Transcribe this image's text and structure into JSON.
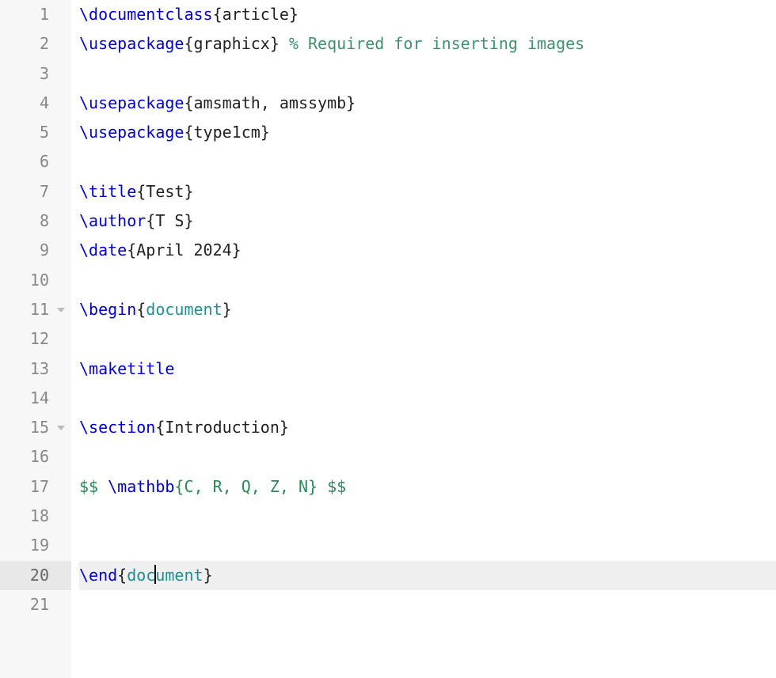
{
  "gutter": {
    "lines": [
      "1",
      "2",
      "3",
      "4",
      "5",
      "6",
      "7",
      "8",
      "9",
      "10",
      "11",
      "12",
      "13",
      "14",
      "15",
      "16",
      "17",
      "18",
      "19",
      "20",
      "21"
    ],
    "activeLine": "20",
    "foldLines": [
      "11",
      "15"
    ]
  },
  "code": {
    "t1_cmd": "\\documentclass",
    "t1_brace": "{article}",
    "t2_cmd": "\\usepackage",
    "t2_brace": "{graphicx}",
    "t2_sp": " ",
    "t2_comment": "% Required for inserting images",
    "t4_cmd": "\\usepackage",
    "t4_brace": "{amsmath, amssymb}",
    "t5_cmd": "\\usepackage",
    "t5_brace": "{type1cm}",
    "t7_cmd": "\\title",
    "t7_brace": "{Test}",
    "t8_cmd": "\\author",
    "t8_brace": "{T S}",
    "t9_cmd": "\\date",
    "t9_brace": "{April 2024}",
    "t11_cmd": "\\begin",
    "t11_ob": "{",
    "t11_env": "document",
    "t11_cb": "}",
    "t13_cmd": "\\maketitle",
    "t15_cmd": "\\section",
    "t15_brace": "{Introduction}",
    "t17_d1": "$$ ",
    "t17_mcmd": "\\mathbb",
    "t17_marg": "{C, R, Q, Z, N}",
    "t17_d2": " $$",
    "t20_cmd": "\\end",
    "t20_ob": "{",
    "t20_env_a": "doc",
    "t20_env_b": "ument",
    "t20_cb": "}"
  }
}
